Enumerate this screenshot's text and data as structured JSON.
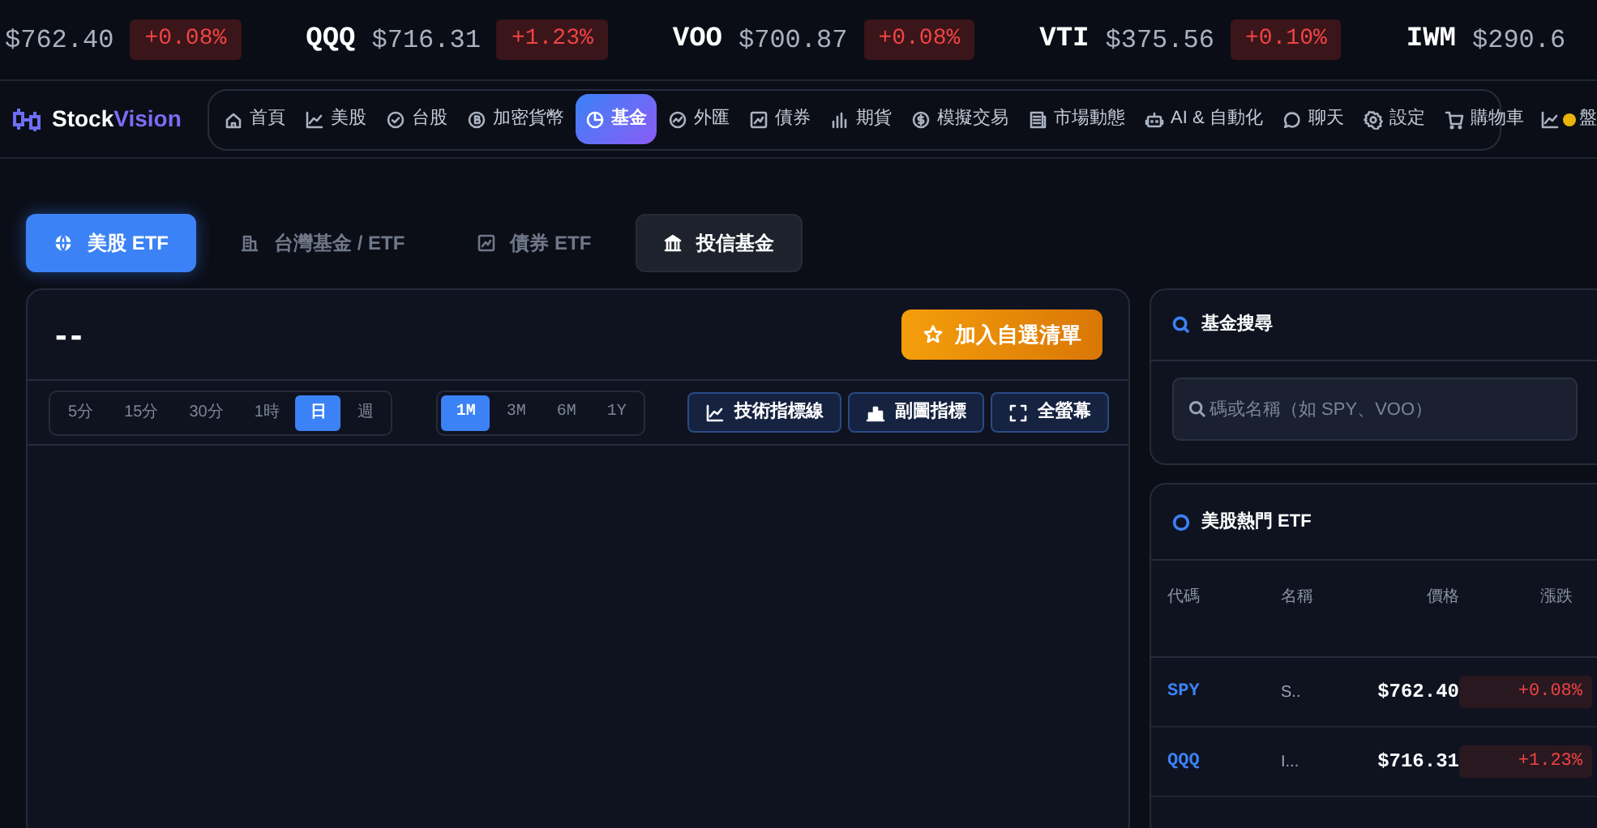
{
  "ticker": [
    {
      "price": "$762.40",
      "change": "+0.08%"
    },
    {
      "symbol": "QQQ",
      "price": "$716.31",
      "change": "+1.23%"
    },
    {
      "symbol": "VOO",
      "price": "$700.87",
      "change": "+0.08%"
    },
    {
      "symbol": "VTI",
      "price": "$375.56",
      "change": "+0.10%"
    },
    {
      "symbol": "IWM",
      "price": "$290.6"
    }
  ],
  "brand": {
    "name": "Stock",
    "accent": "Vision"
  },
  "nav": [
    {
      "label": "首頁",
      "selected": false,
      "dot": false
    },
    {
      "label": "美股",
      "selected": false,
      "dot": false
    },
    {
      "label": "台股",
      "selected": false,
      "dot": false
    },
    {
      "label": "加密貨幣",
      "selected": false,
      "dot": false
    },
    {
      "label": "基金",
      "selected": true,
      "dot": false
    },
    {
      "label": "外匯",
      "selected": false,
      "dot": false
    },
    {
      "label": "債券",
      "selected": false,
      "dot": false
    },
    {
      "label": "期貨",
      "selected": false,
      "dot": false
    },
    {
      "label": "模擬交易",
      "selected": false,
      "dot": false
    },
    {
      "label": "市場動態",
      "selected": false,
      "dot": false
    },
    {
      "label": "AI & 自動化",
      "selected": false,
      "dot": false
    },
    {
      "label": "聊天",
      "selected": false,
      "dot": false
    },
    {
      "label": "設定",
      "selected": false,
      "dot": false
    },
    {
      "label": "購物車",
      "selected": false,
      "dot": false
    },
    {
      "label": "盤",
      "selected": false,
      "dot": true
    }
  ],
  "tabs": [
    {
      "label": "美股 ETF",
      "selected": true,
      "highlighted": false
    },
    {
      "label": "台灣基金 / ETF",
      "selected": false,
      "highlighted": false
    },
    {
      "label": "債券 ETF",
      "selected": false,
      "highlighted": false
    },
    {
      "label": "投信基金",
      "selected": false,
      "highlighted": true
    }
  ],
  "chart_panel": {
    "title": "--",
    "watch_button": "加入自選清單",
    "intervals": [
      {
        "label": "5分",
        "selected": false
      },
      {
        "label": "15分",
        "selected": false
      },
      {
        "label": "30分",
        "selected": false
      },
      {
        "label": "1時",
        "selected": false
      },
      {
        "label": "日",
        "selected": true
      },
      {
        "label": "週",
        "selected": false
      }
    ],
    "ranges": [
      {
        "label": "1M",
        "selected": true
      },
      {
        "label": "3M",
        "selected": false
      },
      {
        "label": "6M",
        "selected": false
      },
      {
        "label": "1Y",
        "selected": false
      }
    ],
    "tools": [
      "技術指標線",
      "副圖指標",
      "全螢幕"
    ]
  },
  "search_card": {
    "title": "基金搜尋",
    "placeholder": "碼或名稱（如 SPY、VOO）"
  },
  "hot_card": {
    "title": "美股熱門 ETF",
    "columns": [
      "代碼",
      "名稱",
      "價格",
      "漲跌"
    ],
    "rows": [
      {
        "symbol": "SPY",
        "name": "S..",
        "price": "$762.40",
        "change": "+0.08%"
      },
      {
        "symbol": "QQQ",
        "name": "I...",
        "price": "$716.31",
        "change": "+1.23%"
      }
    ]
  }
}
